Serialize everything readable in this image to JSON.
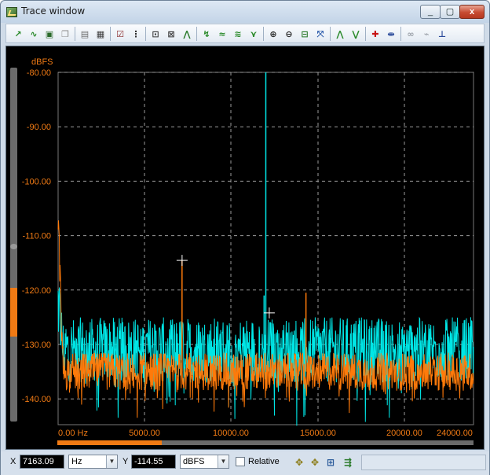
{
  "window": {
    "title": "Trace window",
    "close_glyph": "x",
    "minimize_glyph": "_",
    "maximize_glyph": "▢"
  },
  "toolbar": {
    "buttons": [
      {
        "name": "add-trace-icon",
        "glyph": "↗",
        "color": "#2a8a2a"
      },
      {
        "name": "wave-icon",
        "glyph": "∿",
        "color": "#2a8a2a"
      },
      {
        "name": "save-icon",
        "glyph": "▣",
        "color": "#2a6a2a"
      },
      {
        "name": "copy-icon",
        "glyph": "❐",
        "color": "#8a8a8a"
      },
      {
        "name": "image-icon",
        "glyph": "▤",
        "color": "#6a6a6a"
      },
      {
        "name": "print-icon",
        "glyph": "▦",
        "color": "#3a3a3a"
      },
      {
        "name": "properties-icon",
        "glyph": "☑",
        "color": "#8a2a2a"
      },
      {
        "name": "data-table-icon",
        "glyph": "⋮",
        "color": "#2a2a2a"
      },
      {
        "name": "zoom-fit-icon",
        "glyph": "⊡",
        "color": "#3a3a3a"
      },
      {
        "name": "zoom-x-icon",
        "glyph": "⊠",
        "color": "#3a3a3a"
      },
      {
        "name": "autoscale-icon",
        "glyph": "⋀",
        "color": "#2a7a2a"
      },
      {
        "name": "peak-icon",
        "glyph": "↯",
        "color": "#2a8a2a"
      },
      {
        "name": "smooth-icon",
        "glyph": "≈",
        "color": "#2a8a2a"
      },
      {
        "name": "average-icon",
        "glyph": "≋",
        "color": "#2a8a2a"
      },
      {
        "name": "max-hold-icon",
        "glyph": "⋎",
        "color": "#2a8a2a"
      },
      {
        "name": "zoom-in-icon",
        "glyph": "⊕",
        "color": "#2a2a2a"
      },
      {
        "name": "zoom-out-icon",
        "glyph": "⊖",
        "color": "#2a2a2a"
      },
      {
        "name": "baseline-icon",
        "glyph": "⊟",
        "color": "#2a7a2a"
      },
      {
        "name": "range-icon",
        "glyph": "⤧",
        "color": "#2a5aaa"
      },
      {
        "name": "peak-up-icon",
        "glyph": "⋀",
        "color": "#2a8a2a"
      },
      {
        "name": "peak-down-icon",
        "glyph": "⋁",
        "color": "#2a8a2a"
      },
      {
        "name": "add-cursor-icon",
        "glyph": "✚",
        "color": "#c81414"
      },
      {
        "name": "cursor-pair-icon",
        "glyph": "⇹",
        "color": "#2a4a9a"
      },
      {
        "name": "link-icon",
        "glyph": "∞",
        "color": "#9aa0a8"
      },
      {
        "name": "unlink-icon",
        "glyph": "⌁",
        "color": "#9aa0a8"
      },
      {
        "name": "axis-icon",
        "glyph": "⊥",
        "color": "#2a4a9a"
      }
    ]
  },
  "chart_data": {
    "type": "line",
    "ylabel": "dBFS",
    "xlabel": "",
    "xlim": [
      0,
      24000
    ],
    "ylim": [
      -145,
      -80
    ],
    "y_ticks": [
      "-80.00",
      "-90.00",
      "-100.00",
      "-110.00",
      "-120.00",
      "-130.00",
      "-140.00"
    ],
    "y_tick_values": [
      -80,
      -90,
      -100,
      -110,
      -120,
      -130,
      -140
    ],
    "x_ticks": [
      "0.00 Hz",
      "5000.00",
      "10000.00",
      "15000.00",
      "20000.00",
      "24000.00"
    ],
    "x_tick_values": [
      0,
      5000,
      10000,
      15000,
      20000,
      24000
    ],
    "grid": true,
    "series": [
      {
        "color": "#00e6e6",
        "noise_floor": -131,
        "noise_span": 12,
        "start_level": -122,
        "peaks": [
          {
            "x": 12000,
            "y": -80
          },
          {
            "x": 11900,
            "y": -121
          }
        ]
      },
      {
        "color": "#ff7a0a",
        "noise_floor": -135,
        "noise_span": 7,
        "start_level": -106,
        "peaks": [
          {
            "x": 7160,
            "y": -114.5
          },
          {
            "x": 14320,
            "y": -120.5
          }
        ]
      }
    ],
    "cursors": [
      {
        "x": 7163.09,
        "y": -114.55
      },
      {
        "x": 12200,
        "y": -124.2
      }
    ]
  },
  "status": {
    "x_label": "X",
    "x_value": "7163.09",
    "x_unit": "Hz",
    "y_label": "Y",
    "y_value": "-114.55",
    "y_unit": "dBFS",
    "relative_label": "Relative",
    "relative_checked": false
  },
  "scroll": {
    "horizontal_fraction": 0.25
  }
}
